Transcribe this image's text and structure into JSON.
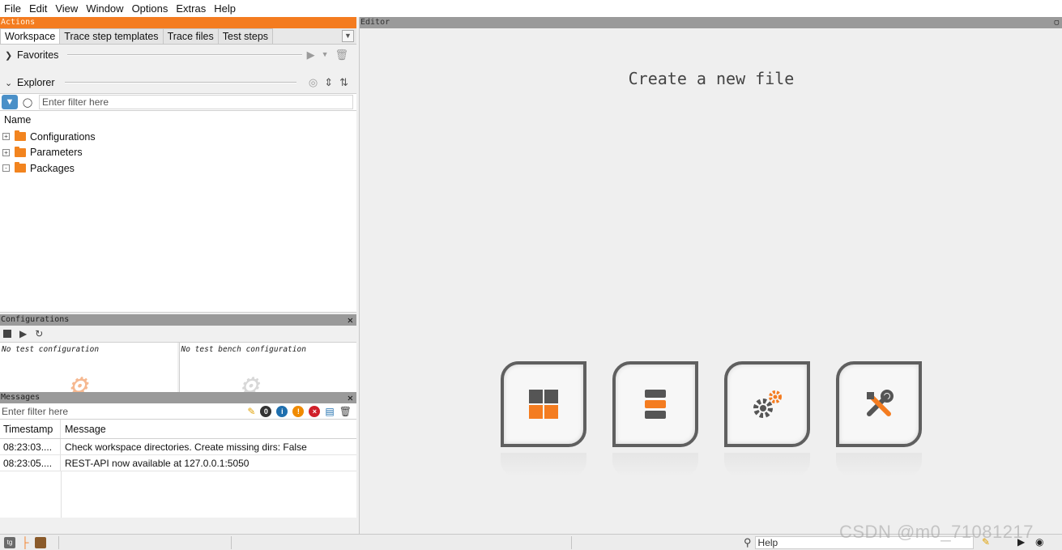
{
  "menubar": {
    "items": [
      "File",
      "Edit",
      "View",
      "Window",
      "Options",
      "Extras",
      "Help"
    ]
  },
  "actions_panel": {
    "title": "Actions",
    "tabs": [
      "Workspace",
      "Trace step templates",
      "Trace files",
      "Test steps"
    ],
    "active_tab": "Workspace",
    "favorites": {
      "label": "Favorites"
    },
    "explorer": {
      "label": "Explorer",
      "filter_placeholder": "Enter filter here",
      "column_header": "Name",
      "items": [
        {
          "label": "Configurations",
          "expander": "+"
        },
        {
          "label": "Parameters",
          "expander": "+"
        },
        {
          "label": "Packages",
          "expander": "-"
        }
      ]
    }
  },
  "configurations_panel": {
    "title": "Configurations",
    "test_configuration": "No test configuration",
    "test_bench_configuration": "No test bench configuration"
  },
  "messages_panel": {
    "title": "Messages",
    "filter_placeholder": "Enter filter here",
    "columns": [
      "Timestamp",
      "Message"
    ],
    "rows": [
      {
        "timestamp": "08:23:03....",
        "message": "Check workspace directories. Create missing dirs: False"
      },
      {
        "timestamp": "08:23:05....",
        "message": "REST-API now available at 127.0.0.1:5050"
      }
    ]
  },
  "editor": {
    "title": "Editor",
    "heading": "Create a new file",
    "tiles": [
      "grid-package-icon",
      "stack-project-icon",
      "gears-config-icon",
      "tools-icon"
    ]
  },
  "statusbar": {
    "help_placeholder": "Help"
  },
  "watermark": "CSDN @m0_71081217",
  "colors": {
    "accent": "#f47c20",
    "panel_title_gray": "#9a9a9a",
    "tile_border": "#5f5f5f"
  }
}
